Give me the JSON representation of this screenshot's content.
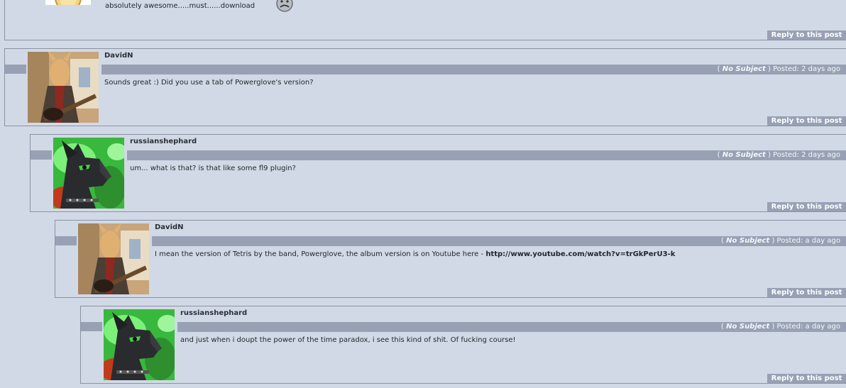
{
  "top_post": {
    "body": "absolutely awesome.....must......download",
    "reply_label": "Reply to this post"
  },
  "posts": [
    {
      "username": "DavidN",
      "subject_open": "(",
      "subject": "No Subject",
      "subject_close": ")",
      "posted": "Posted: 2 days ago",
      "body": "Sounds great :) Did you use a tab of Powerglove's version?",
      "reply_label": "Reply to this post"
    },
    {
      "username": "russianshephard",
      "subject_open": "(",
      "subject": "No Subject",
      "subject_close": ")",
      "posted": "Posted: 2 days ago",
      "body": "um... what is that? is that like some fl9 plugin?",
      "reply_label": "Reply to this post"
    },
    {
      "username": "DavidN",
      "subject_open": "(",
      "subject": "No Subject",
      "subject_close": ")",
      "posted": "Posted: a day ago",
      "body": "I mean the version of Tetris by the band, Powerglove, the album version is on Youtube here -",
      "link": "http://www.youtube.com/watch?v=trGkPerU3-k",
      "reply_label": "Reply to this post"
    },
    {
      "username": "russianshephard",
      "subject_open": "(",
      "subject": "No Subject",
      "subject_close": ")",
      "posted": "Posted: a day ago",
      "body": "and just when i doupt the power of the time paradox, i see this kind of shit. Of fucking course!",
      "reply_label": "Reply to this post"
    }
  ]
}
